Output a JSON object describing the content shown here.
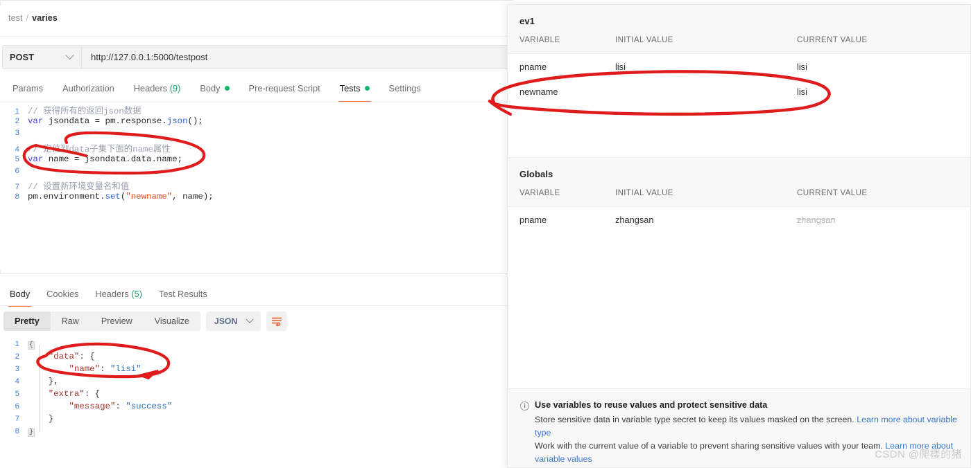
{
  "breadcrumb": {
    "parent": "test",
    "separator": "/",
    "current": "varies"
  },
  "request": {
    "method": "POST",
    "url": "http://127.0.0.1:5000/testpost",
    "tabs": [
      {
        "label": "Params",
        "active": false,
        "dot": false,
        "count": ""
      },
      {
        "label": "Authorization",
        "active": false,
        "dot": false,
        "count": ""
      },
      {
        "label": "Headers",
        "active": false,
        "dot": false,
        "count": "(9)"
      },
      {
        "label": "Body",
        "active": false,
        "dot": true,
        "count": ""
      },
      {
        "label": "Pre-request Script",
        "active": false,
        "dot": false,
        "count": ""
      },
      {
        "label": "Tests",
        "active": true,
        "dot": true,
        "count": ""
      },
      {
        "label": "Settings",
        "active": false,
        "dot": false,
        "count": ""
      }
    ]
  },
  "script_editor": {
    "lines": [
      {
        "n": "1",
        "tokens": [
          {
            "t": "// 获得所有的返回json数据",
            "c": "c-cmt"
          }
        ]
      },
      {
        "n": "2",
        "tokens": [
          {
            "t": "var",
            "c": "c-kw"
          },
          {
            "t": " jsondata ",
            "c": "c-pl"
          },
          {
            "t": "=",
            "c": "c-pl"
          },
          {
            "t": " pm",
            "c": "c-pl"
          },
          {
            "t": ".",
            "c": "c-pl"
          },
          {
            "t": "response",
            "c": "c-pl"
          },
          {
            "t": ".",
            "c": "c-pl"
          },
          {
            "t": "json",
            "c": "c-fn"
          },
          {
            "t": "();",
            "c": "c-pl"
          }
        ]
      },
      {
        "n": "3",
        "tokens": []
      },
      {
        "n": "4",
        "tokens": [
          {
            "t": "// 定位到data子集下面的name属性",
            "c": "c-cmt"
          }
        ]
      },
      {
        "n": "5",
        "tokens": [
          {
            "t": "var",
            "c": "c-kw"
          },
          {
            "t": " name ",
            "c": "c-pl"
          },
          {
            "t": "=",
            "c": "c-pl"
          },
          {
            "t": " jsondata",
            "c": "c-pl"
          },
          {
            "t": ".",
            "c": "c-pl"
          },
          {
            "t": "data",
            "c": "c-pl"
          },
          {
            "t": ".",
            "c": "c-pl"
          },
          {
            "t": "name",
            "c": "c-pl"
          },
          {
            "t": ";",
            "c": "c-pl"
          }
        ]
      },
      {
        "n": "6",
        "tokens": []
      },
      {
        "n": "7",
        "tokens": [
          {
            "t": "// 设置新环境变量名和值",
            "c": "c-cmt"
          }
        ]
      },
      {
        "n": "8",
        "tokens": [
          {
            "t": "pm",
            "c": "c-pl"
          },
          {
            "t": ".",
            "c": "c-pl"
          },
          {
            "t": "environment",
            "c": "c-pl"
          },
          {
            "t": ".",
            "c": "c-pl"
          },
          {
            "t": "set",
            "c": "c-fn"
          },
          {
            "t": "(",
            "c": "c-pl"
          },
          {
            "t": "\"newname\"",
            "c": "c-str"
          },
          {
            "t": ", name);",
            "c": "c-pl"
          }
        ]
      }
    ]
  },
  "response": {
    "tabs": [
      {
        "label": "Body",
        "active": true,
        "count": ""
      },
      {
        "label": "Cookies",
        "active": false,
        "count": ""
      },
      {
        "label": "Headers",
        "active": false,
        "count": "(5)"
      },
      {
        "label": "Test Results",
        "active": false,
        "count": ""
      }
    ],
    "view_modes": [
      {
        "label": "Pretty",
        "active": true
      },
      {
        "label": "Raw",
        "active": false
      },
      {
        "label": "Preview",
        "active": false
      },
      {
        "label": "Visualize",
        "active": false
      }
    ],
    "format": "JSON",
    "wrap_icon": "wrap-lines-icon",
    "body_lines": [
      {
        "n": "1",
        "fold": "{",
        "tokens": []
      },
      {
        "n": "2",
        "tokens": [
          {
            "t": "    ",
            "c": "j-pun"
          },
          {
            "t": "\"data\"",
            "c": "j-key"
          },
          {
            "t": ": {",
            "c": "j-pun"
          }
        ]
      },
      {
        "n": "3",
        "tokens": [
          {
            "t": "        ",
            "c": "j-pun"
          },
          {
            "t": "\"name\"",
            "c": "j-key"
          },
          {
            "t": ": ",
            "c": "j-pun"
          },
          {
            "t": "\"lisi\"",
            "c": "j-str"
          }
        ]
      },
      {
        "n": "4",
        "tokens": [
          {
            "t": "    },",
            "c": "j-pun"
          }
        ]
      },
      {
        "n": "5",
        "tokens": [
          {
            "t": "    ",
            "c": "j-pun"
          },
          {
            "t": "\"extra\"",
            "c": "j-key"
          },
          {
            "t": ": {",
            "c": "j-pun"
          }
        ]
      },
      {
        "n": "6",
        "tokens": [
          {
            "t": "        ",
            "c": "j-pun"
          },
          {
            "t": "\"message\"",
            "c": "j-key"
          },
          {
            "t": ": ",
            "c": "j-pun"
          },
          {
            "t": "\"success\"",
            "c": "j-str"
          }
        ]
      },
      {
        "n": "7",
        "tokens": [
          {
            "t": "    }",
            "c": "j-pun"
          }
        ]
      },
      {
        "n": "8",
        "fold": "}",
        "tokens": []
      }
    ]
  },
  "env_panel": {
    "columns": {
      "variable": "VARIABLE",
      "initial": "INITIAL VALUE",
      "current": "CURRENT VALUE"
    },
    "sections": [
      {
        "title": "ev1",
        "rows": [
          {
            "variable": "pname",
            "initial": "lisi",
            "current": "lisi",
            "current_muted": false
          },
          {
            "variable": "newname",
            "initial": "",
            "current": "lisi",
            "current_muted": false
          }
        ]
      },
      {
        "title": "Globals",
        "rows": [
          {
            "variable": "pname",
            "initial": "zhangsan",
            "current": "zhangsan",
            "current_muted": true
          }
        ]
      }
    ],
    "footer": {
      "icon": "info-icon",
      "title": "Use variables to reuse values and protect sensitive data",
      "line1_text": "Store sensitive data in variable type secret to keep its values masked on the screen. ",
      "line1_link": "Learn more about variable type",
      "line2_text": "Work with the current value of a variable to prevent sharing sensitive values with your team. ",
      "line2_link": "Learn more about variable values"
    }
  },
  "watermark": "CSDN @爬楼的猪",
  "colors": {
    "accent_orange": "#ff6c37",
    "status_green": "#15b471",
    "link_blue": "#3a77c9",
    "annotation_red": "#e01b1b"
  }
}
